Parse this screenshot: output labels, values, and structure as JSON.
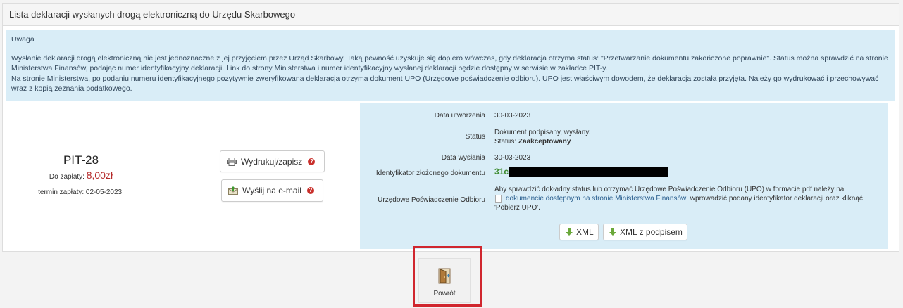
{
  "panel": {
    "title": "Lista deklaracji wysłanych drogą elektroniczną do Urzędu Skarbowego"
  },
  "notice": {
    "title": "Uwaga",
    "paragraph1": "Wysłanie deklaracji drogą elektroniczną nie jest jednoznaczne z jej przyjęciem przez Urząd Skarbowy. Taką pewność uzyskuje się dopiero wówczas, gdy deklaracja otrzyma status: \"Przetwarzanie dokumentu zakończone poprawnie\". Status można sprawdzić na stronie Ministerstwa Finansów, podając numer identyfikacyjny deklaracji. Link do strony Ministerstwa i numer identyfikacyjny wysłanej deklaracji będzie dostępny w serwisie w zakładce PIT-y.",
    "paragraph2": "Na stronie Ministerstwa, po podaniu numeru identyfikacyjnego pozytywnie zweryfikowana deklaracja otrzyma dokument UPO (Urzędowe poświadczenie odbioru). UPO jest właściwym dowodem, że deklaracja została przyjęta. Należy go wydrukować i przechowywać wraz z kopią zeznania podatkowego."
  },
  "declaration": {
    "form": "PIT-28",
    "amount_label": "Do zapłaty:",
    "amount": "8,00zł",
    "due": "termin zapłaty: 02-05-2023."
  },
  "actions": {
    "print_label": "Wydrukuj/zapisz",
    "email_label": "Wyślij na e-mail",
    "help_glyph": "?"
  },
  "details": {
    "created_label": "Data utworzenia",
    "created_value": "30-03-2023",
    "status_label": "Status",
    "status_line1": "Dokument podpisany, wysłany.",
    "status_line2_prefix": "Status:",
    "status_line2_value": "Zaakceptowany",
    "sent_label": "Data wysłania",
    "sent_value": "30-03-2023",
    "id_label": "Identyfikator złożonego dokumentu",
    "id_value_visible": "31c",
    "upo_label": "Urzędowe Poświadczenie Odbioru",
    "upo_text_before": "Aby sprawdzić dokładny status lub otrzymać Urzędowe Poświadczenie Odbioru (UPO) w formacie pdf należy na",
    "upo_link": "dokumencie dostępnym na stronie Ministerstwa Finansów",
    "upo_text_after": "wprowadzić podany identyfikator deklaracji oraz kliknąć 'Pobierz UPO'.",
    "xml_label": "XML",
    "xml_signed_label": "XML z podpisem"
  },
  "footer": {
    "back_label": "Powrót"
  },
  "colors": {
    "info_bg": "#d9edf7",
    "amount_red": "#b52a2a",
    "highlight_red": "#d0262e",
    "id_green": "#3c8a2e"
  }
}
